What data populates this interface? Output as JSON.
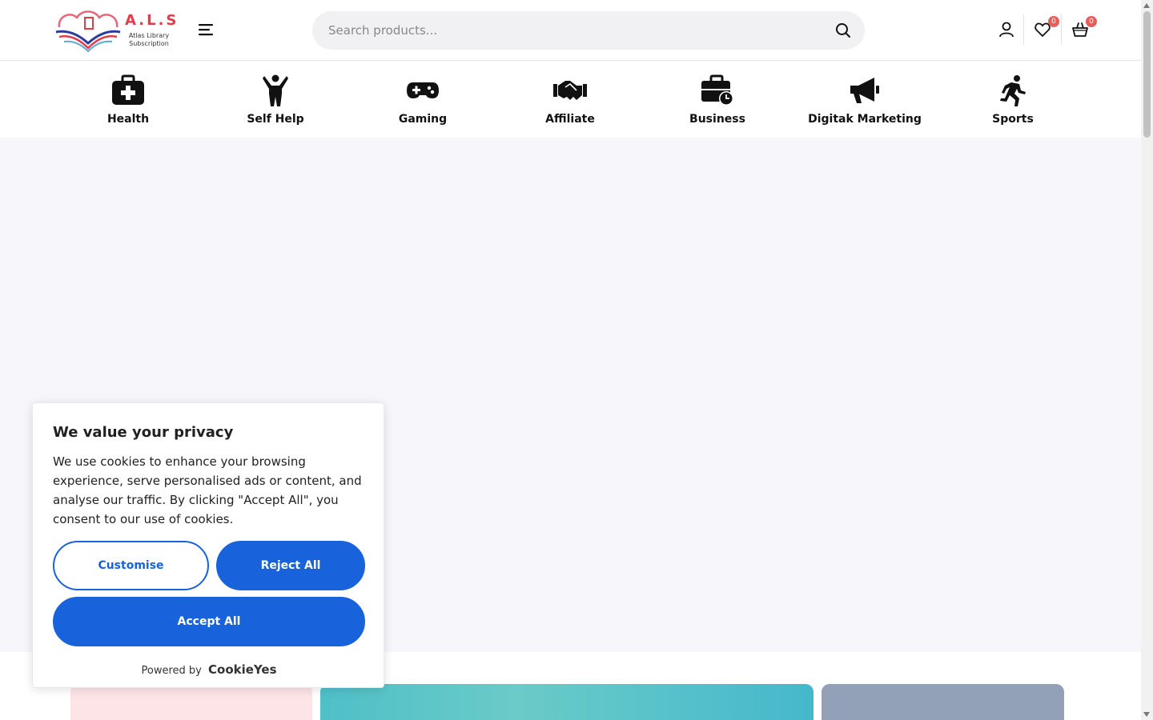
{
  "header": {
    "logo": {
      "title": "A.L.S",
      "subtitle": "Atlas Library Subscription"
    },
    "search": {
      "placeholder": "Search products..."
    },
    "wishlist_count": "0",
    "cart_count": "0"
  },
  "categories": [
    {
      "label": "Health",
      "icon": "medkit-icon"
    },
    {
      "label": "Self Help",
      "icon": "person-arms-up-icon"
    },
    {
      "label": "Gaming",
      "icon": "gamepad-icon"
    },
    {
      "label": "Affiliate",
      "icon": "handshake-icon"
    },
    {
      "label": "Business",
      "icon": "briefcase-clock-icon"
    },
    {
      "label": "Digitak Marketing",
      "icon": "megaphone-icon"
    },
    {
      "label": "Sports",
      "icon": "running-icon"
    }
  ],
  "cookie": {
    "title": "We value your privacy",
    "text": "We use cookies to enhance your browsing experience, serve personalised ads or content, and analyse our traffic. By clicking \"Accept All\", you consent to our use of cookies.",
    "customise_label": "Customise",
    "reject_label": "Reject All",
    "accept_label": "Accept All",
    "powered_by": "Powered by",
    "brand": "CookieYes"
  },
  "colors": {
    "accent": "#1863dc",
    "badge": "#e85c5c",
    "logo_red": "#e23b4a",
    "hero_bg": "#f7f7fb"
  }
}
